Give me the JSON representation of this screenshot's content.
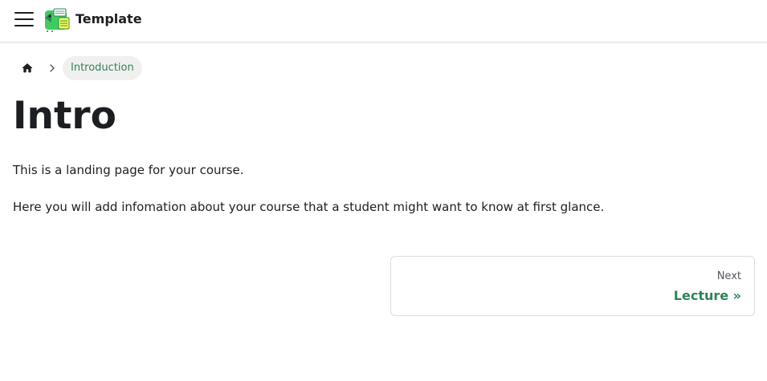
{
  "navbar": {
    "title": "Template",
    "menu_icon": "hamburger-menu-icon",
    "logo_icon": "dinosaur-logo-icon"
  },
  "breadcrumb": {
    "home_icon": "home-icon",
    "separator_icon": "chevron-right-icon",
    "current": "Introduction"
  },
  "content": {
    "title": "Intro",
    "paragraphs": [
      "This is a landing page for your course.",
      "Here you will add infomation about your course that a student might want to know at first glance."
    ]
  },
  "pagination": {
    "next_sublabel": "Next",
    "next_label": "Lecture »"
  },
  "colors": {
    "accent": "#2e8555",
    "text": "#1c1e21",
    "muted": "#525860",
    "breadcrumb_bg": "#f0f0f0",
    "border": "#dadde1"
  }
}
